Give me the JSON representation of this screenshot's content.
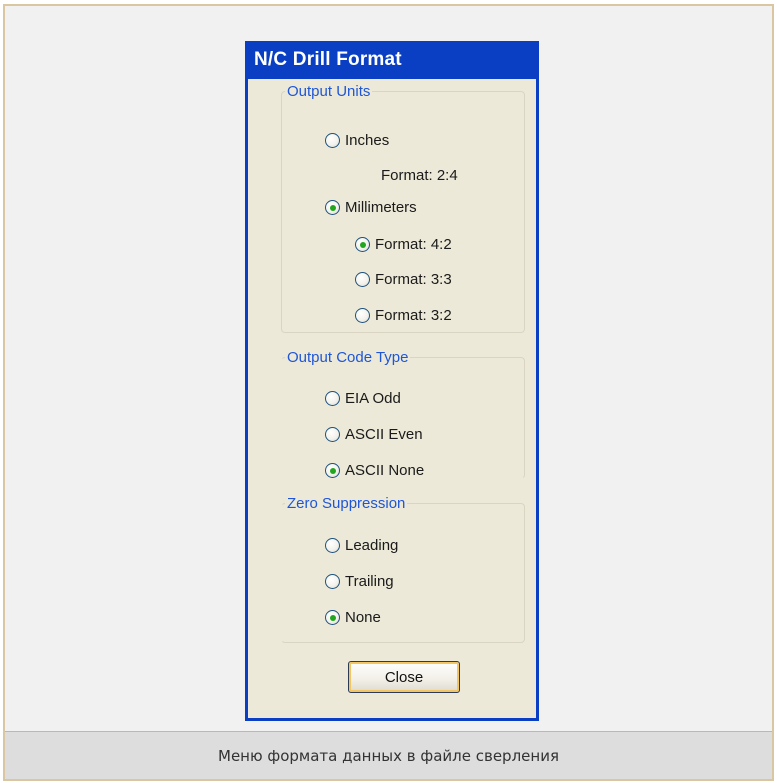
{
  "dialog": {
    "title": "N/C Drill Format",
    "close_label": "Close"
  },
  "output_units": {
    "legend": "Output Units",
    "inches_label": "Inches",
    "inches_format": "Format: 2:4",
    "millimeters_label": "Millimeters",
    "mm_formats": [
      "Format: 4:2",
      "Format: 3:3",
      "Format: 3:2"
    ],
    "selected_unit": "Millimeters",
    "selected_mm_format": "Format: 4:2"
  },
  "output_code_type": {
    "legend": "Output Code Type",
    "options": [
      "EIA Odd",
      "ASCII Even",
      "ASCII None"
    ],
    "selected": "ASCII None"
  },
  "zero_suppression": {
    "legend": "Zero Suppression",
    "options": [
      "Leading",
      "Trailing",
      "None"
    ],
    "selected": "None"
  },
  "caption": "Меню формата данных в файле сверления",
  "colors": {
    "titlebar": "#0a3fc4",
    "dialog_face": "#ece9d8",
    "legend_text": "#1f56d6",
    "radio_selected_dot": "#22a61f",
    "button_focus": "#f4c661"
  }
}
